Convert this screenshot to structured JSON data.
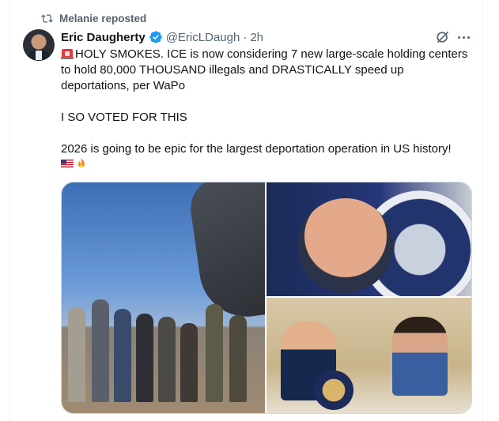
{
  "repost": {
    "label": "Melanie reposted"
  },
  "author": {
    "name": "Eric Daugherty",
    "handle": "@EricLDaugh",
    "separator": "·",
    "time": "2h",
    "verified_color": "#1d9bf0"
  },
  "post": {
    "line1": "HOLY SMOKES. ICE is now considering 7 new large-scale holding centers to hold 80,000 THOUSAND illegals and DRASTICALLY speed up deportations, per WaPo",
    "line2": "I SO VOTED FOR THIS",
    "line3": "2026 is going to be epic for the largest deportation operation in US history!",
    "emojis": [
      "siren-emoji",
      "us-flag-emoji",
      "fire-emoji"
    ]
  },
  "media": {
    "images": [
      "deportation-flight-photo",
      "ice-official-photo",
      "white-house-meeting-photo"
    ]
  },
  "icons": [
    "repost-icon",
    "verified-badge-icon",
    "grok-icon",
    "more-icon"
  ]
}
